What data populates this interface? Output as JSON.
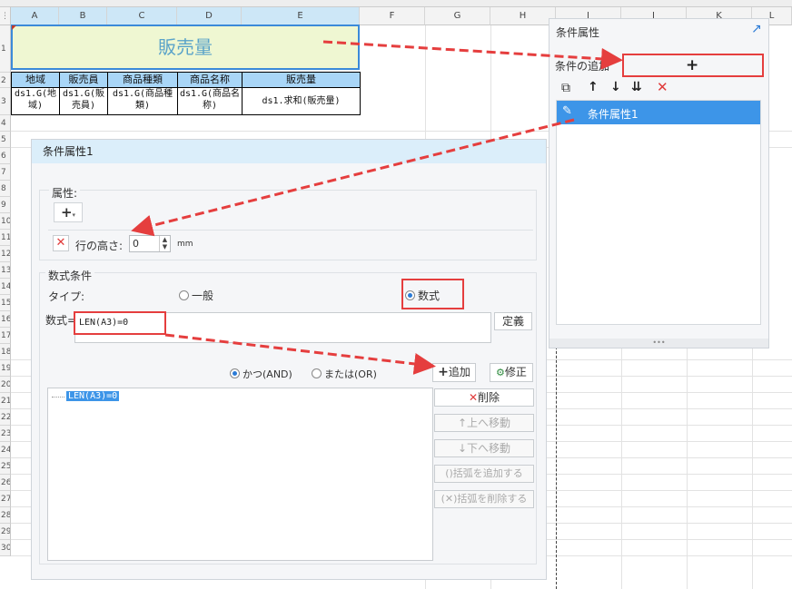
{
  "columns": [
    "A",
    "B",
    "C",
    "D",
    "E",
    "F",
    "G",
    "H",
    "I",
    "J",
    "K",
    "L"
  ],
  "rows": [
    "1",
    "2",
    "3",
    "4",
    "5",
    "6",
    "7",
    "8",
    "9",
    "10",
    "11",
    "12",
    "13",
    "14",
    "15",
    "16",
    "17",
    "18",
    "19",
    "20",
    "21",
    "22",
    "23",
    "24",
    "25",
    "26",
    "27",
    "28",
    "29",
    "30"
  ],
  "sheet": {
    "title": "販売量",
    "headers": [
      "地域",
      "販売員",
      "商品種類",
      "商品名称",
      "販売量"
    ],
    "cells": [
      "ds1.G(地域)",
      "ds1.G(販売員)",
      "ds1.G(商品種類)",
      "ds1.G(商品名称)",
      "ds1.求和(販売量)"
    ]
  },
  "panel": {
    "title": "条件属性",
    "add_label": "条件の追加",
    "add_symbol": "+",
    "item": "条件属性1"
  },
  "dialog": {
    "title": "条件属性1",
    "attr_label": "属性:",
    "row_height_label": "行の高さ:",
    "row_height_value": "0",
    "unit": "mm",
    "formula_section": "数式条件",
    "type_label": "タイプ:",
    "type_general": "一般",
    "type_formula": "数式",
    "formula_label": "数式=",
    "formula_value": "LEN(A3)=0",
    "define": "定義",
    "and_label": "かつ(AND)",
    "or_label": "または(OR)",
    "add": "追加",
    "modify": "修正",
    "list_item": "LEN(A3)=0",
    "delete": "削除",
    "move_up": "上へ移動",
    "move_down": "下へ移動",
    "add_paren": "括弧を追加する",
    "remove_paren": "括弧を削除する"
  }
}
